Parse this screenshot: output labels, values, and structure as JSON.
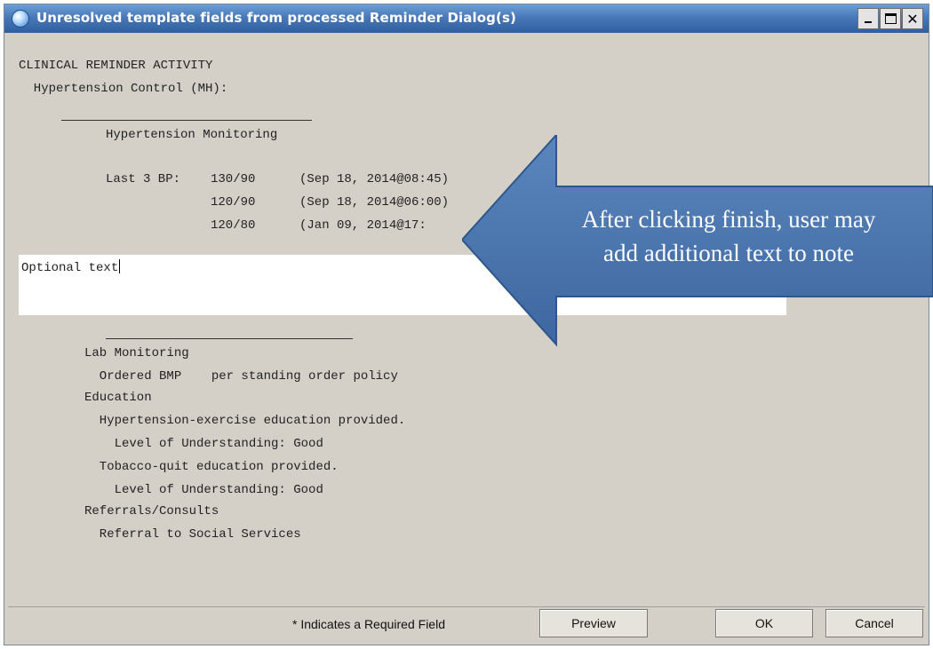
{
  "window": {
    "title": "Unresolved template fields from processed Reminder Dialog(s)",
    "controls": {
      "minimize": "minimize-icon",
      "maximize": "maximize-icon",
      "close": "close-icon"
    }
  },
  "note": {
    "header_line1": "CLINICAL REMINDER ACTIVITY",
    "header_line2": "  Hypertension Control (MH):",
    "section_title": "Hypertension Monitoring",
    "bp_label": "Last 3 BP:",
    "bp_readings": [
      {
        "value": "130/90",
        "date": "(Sep 18, 2014@08:45)"
      },
      {
        "value": "120/90",
        "date": "(Sep 18, 2014@06:00)"
      },
      {
        "value": "120/80",
        "date": "(Jan 09, 2014@17:"
      }
    ],
    "optional_text": "Optional text",
    "lines": [
      "Lab Monitoring",
      "  Ordered BMP    per standing order policy",
      "Education",
      "  Hypertension-exercise education provided.",
      "    Level of Understanding: Good",
      "  Tobacco-quit education provided.",
      "    Level of Understanding: Good",
      "Referrals/Consults",
      "  Referral to Social Services"
    ]
  },
  "callout": {
    "line1": "After clicking finish, user may",
    "line2": "add additional text to note",
    "fill_color": "#4a74aa"
  },
  "footer": {
    "required_note": "* Indicates a Required Field",
    "preview_label": "Preview",
    "ok_label": "OK",
    "cancel_label": "Cancel"
  }
}
